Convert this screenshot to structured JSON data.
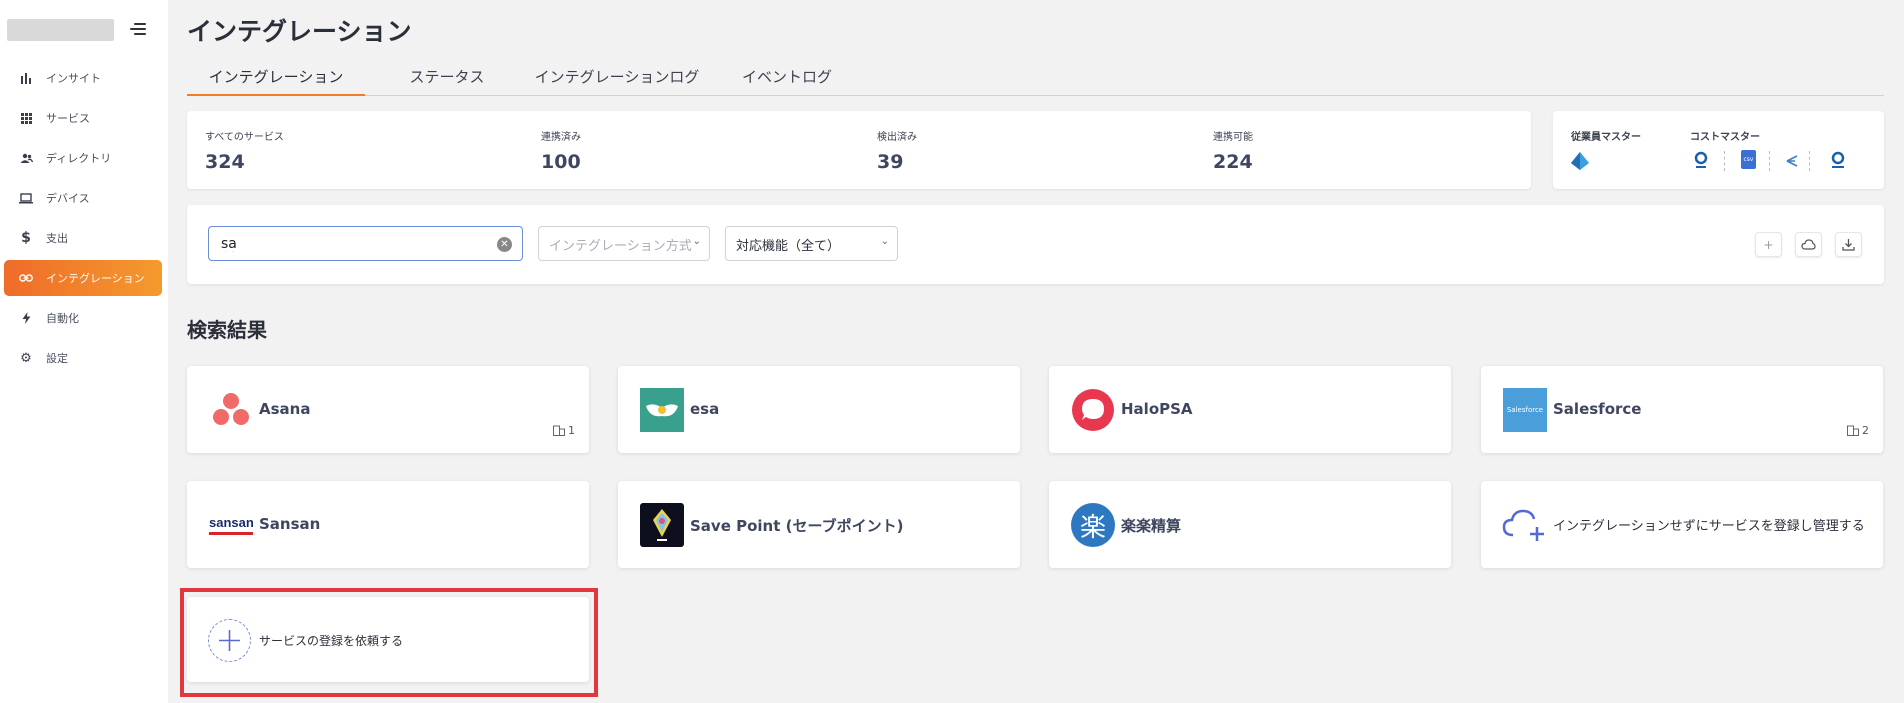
{
  "sidebar": {
    "items": [
      {
        "label": "インサイト",
        "icon": "bar-chart-icon"
      },
      {
        "label": "サービス",
        "icon": "grid-icon"
      },
      {
        "label": "ディレクトリ",
        "icon": "users-icon"
      },
      {
        "label": "デバイス",
        "icon": "laptop-icon"
      },
      {
        "label": "支出",
        "icon": "dollar-icon"
      },
      {
        "label": "インテグレーション",
        "icon": "link-icon",
        "active": true
      },
      {
        "label": "自動化",
        "icon": "lightning-icon"
      },
      {
        "label": "設定",
        "icon": "gear-icon"
      }
    ]
  },
  "header": {
    "title": "インテグレーション",
    "tabs": [
      {
        "label": "インテグレーション",
        "active": true
      },
      {
        "label": "ステータス"
      },
      {
        "label": "インテグレーションログ"
      },
      {
        "label": "イベントログ"
      }
    ]
  },
  "stats": [
    {
      "label": "すべてのサービス",
      "value": "324"
    },
    {
      "label": "連携済み",
      "value": "100"
    },
    {
      "label": "検出済み",
      "value": "39"
    },
    {
      "label": "連携可能",
      "value": "224"
    }
  ],
  "masters": {
    "employee_label": "従業員マスター",
    "cost_label": "コストマスター",
    "csv_label": "csv"
  },
  "filters": {
    "search_value": "sa",
    "method_placeholder": "インテグレーション方式",
    "feature_value": "対応機能（全て）"
  },
  "results": {
    "title": "検索結果",
    "services": [
      {
        "name": "Asana",
        "count": "1"
      },
      {
        "name": "esa"
      },
      {
        "name": "HaloPSA"
      },
      {
        "name": "Salesforce",
        "count": "2",
        "logo_text": "Salesforce"
      },
      {
        "name": "Sansan",
        "logo_text": "sansan"
      },
      {
        "name": "Save Point (セーブポイント)"
      },
      {
        "name": "楽楽精算",
        "logo_text": "楽"
      },
      {
        "name": "インテグレーションせずにサービスを登録し管理する"
      }
    ],
    "request_label": "サービスの登録を依頼する"
  },
  "colors": {
    "accent": "#ef7d2c",
    "highlight": "#e0383e"
  }
}
